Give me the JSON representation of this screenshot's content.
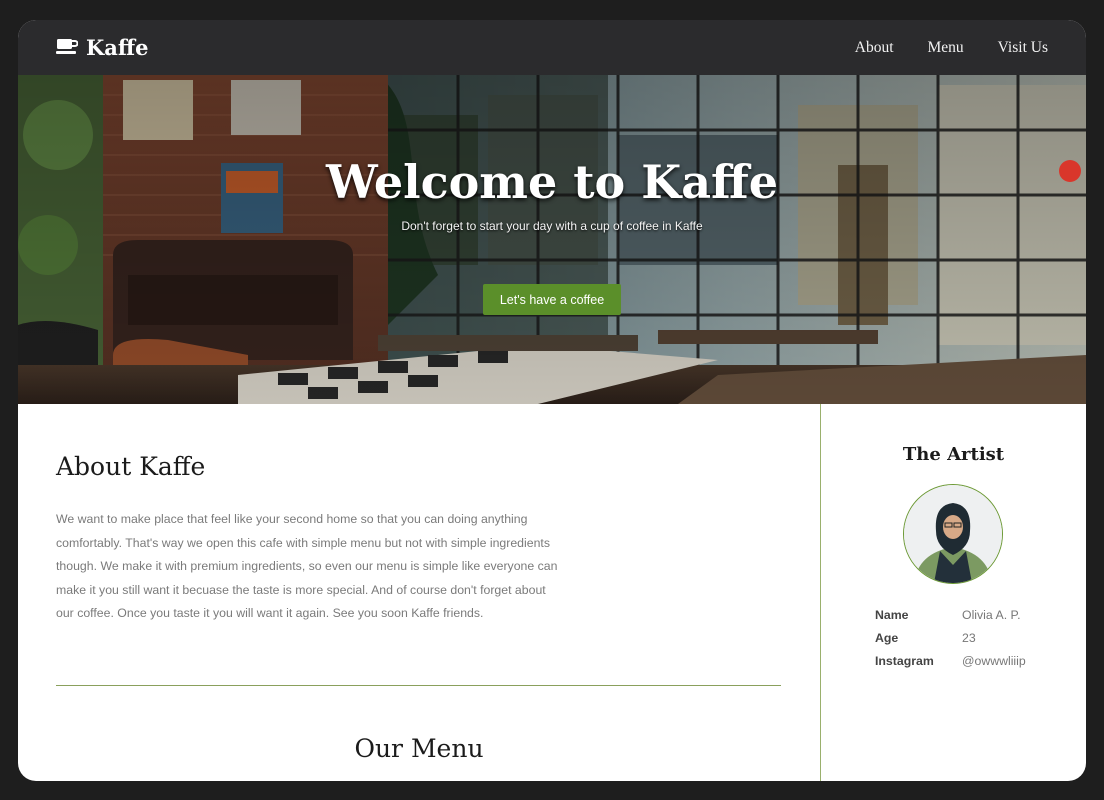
{
  "brand": {
    "name": "Kaffe",
    "icon": "coffee-cup-icon"
  },
  "nav": {
    "items": [
      {
        "label": "About"
      },
      {
        "label": "Menu"
      },
      {
        "label": "Visit Us"
      }
    ]
  },
  "hero": {
    "title": "Welcome to Kaffe",
    "subtitle": "Don't forget to start your day with a cup of coffee in Kaffe",
    "cta": "Let's have a coffee"
  },
  "about": {
    "title": "About Kaffe",
    "text": "We want to make place that feel like your second home so that you can doing anything comfortably. That's way we open this cafe with simple menu but not with simple ingredients though. We make it with premium ingredients, so even our menu is simple like everyone can make it you still want it becuase the taste is more special. And of course don't forget about our coffee. Once you taste it you will want it again. See you soon Kaffe friends."
  },
  "menu": {
    "title": "Our Menu"
  },
  "artist": {
    "title": "The Artist",
    "info": [
      {
        "label": "Name",
        "value": "Olivia A. P."
      },
      {
        "label": "Age",
        "value": "23"
      },
      {
        "label": "Instagram",
        "value": "@owwwliiip"
      }
    ]
  },
  "colors": {
    "accent": "#5b8f2a",
    "navbar": "#2b2b2d",
    "frame": "#1e1e1e",
    "divider": "#8aa05c"
  }
}
